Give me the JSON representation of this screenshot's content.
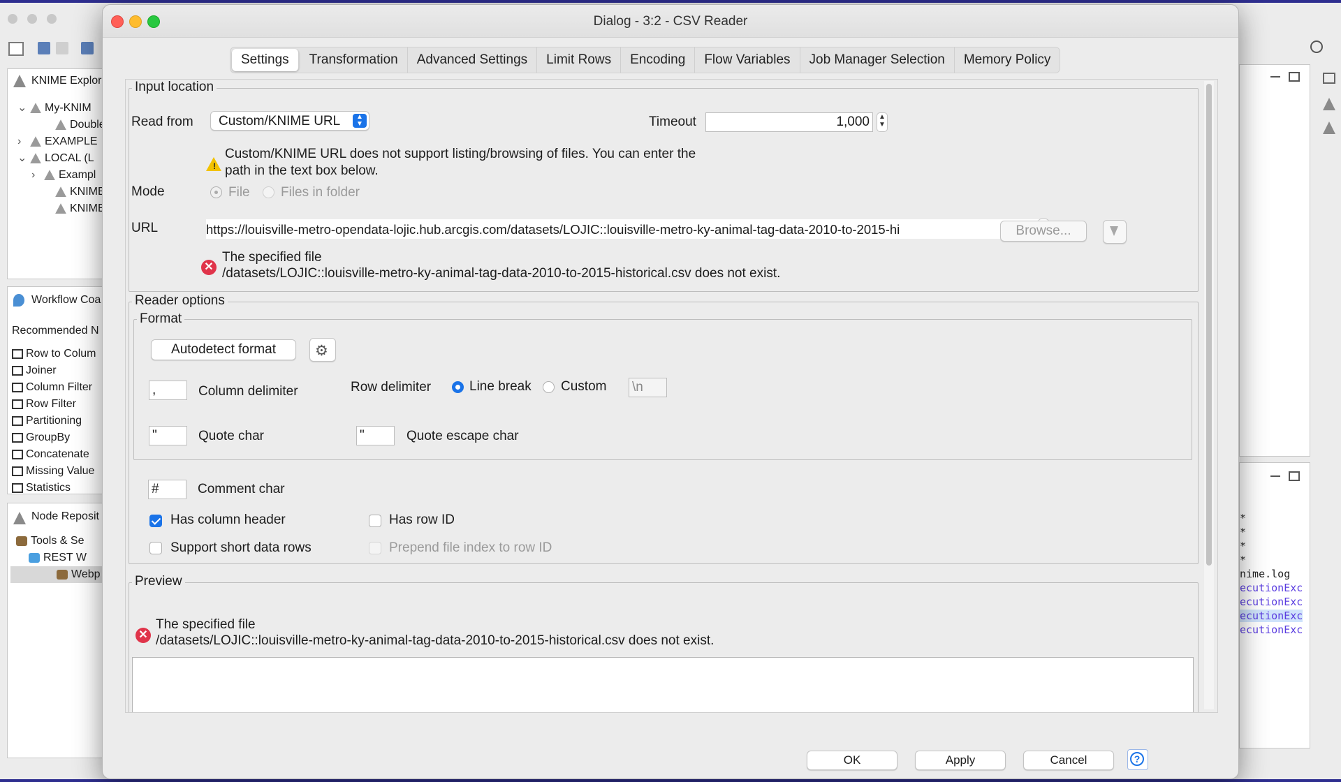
{
  "background": {
    "explorer_title": "KNIME Explor",
    "explorer_items": [
      {
        "toggle": "⌄",
        "label": "My-KNIM"
      },
      {
        "toggle": "",
        "label": "Double"
      },
      {
        "toggle": "›",
        "label": "EXAMPLE"
      },
      {
        "toggle": "⌄",
        "label": "LOCAL (L"
      },
      {
        "toggle": "›",
        "label": "Exampl"
      },
      {
        "toggle": "",
        "label": "KNIME_"
      },
      {
        "toggle": "",
        "label": "KNIME_"
      }
    ],
    "coach_title": "Workflow Coa",
    "recommended_label": "Recommended N",
    "recommended_nodes": [
      "Row to Colum",
      "Joiner",
      "Column Filter",
      "Row Filter",
      "Partitioning",
      "GroupBy",
      "Concatenate",
      "Missing Value",
      "Statistics"
    ],
    "repo_title": "Node Reposit",
    "repo_items": [
      "Tools & Se",
      "REST W",
      "Webp"
    ],
    "console_lines": [
      "*",
      "*",
      "*",
      "*",
      "nime.log",
      "ecutionExc",
      "ecutionExc",
      "ecutionExc",
      "ecutionExc"
    ]
  },
  "dialog": {
    "title": "Dialog - 3:2 - CSV Reader",
    "tabs": [
      "Settings",
      "Transformation",
      "Advanced Settings",
      "Limit Rows",
      "Encoding",
      "Flow Variables",
      "Job Manager Selection",
      "Memory Policy"
    ],
    "input_location": {
      "legend": "Input location",
      "read_from_label": "Read from",
      "read_from_value": "Custom/KNIME URL",
      "timeout_label": "Timeout",
      "timeout_value": "1,000",
      "warning_line1": "Custom/KNIME URL does not support listing/browsing of files. You can enter the",
      "warning_line2": "path in the text box below.",
      "mode_label": "Mode",
      "mode_file": "File",
      "mode_folder": "Files in folder",
      "url_label": "URL",
      "url_value": "https://louisville-metro-opendata-lojic.hub.arcgis.com/datasets/LOJIC::louisville-metro-ky-animal-tag-data-2010-to-2015-hi",
      "browse_label": "Browse...",
      "error_line1": "The specified file",
      "error_line2": "/datasets/LOJIC::louisville-metro-ky-animal-tag-data-2010-to-2015-historical.csv does not exist."
    },
    "reader_options": {
      "legend": "Reader options",
      "format_legend": "Format",
      "autodetect_label": "Autodetect format",
      "column_delimiter_value": ",",
      "column_delimiter_label": "Column delimiter",
      "row_delimiter_label": "Row delimiter",
      "line_break_label": "Line break",
      "custom_label": "Custom",
      "custom_value": "\\n",
      "quote_char_value": "\"",
      "quote_char_label": "Quote char",
      "quote_escape_value": "\"",
      "quote_escape_label": "Quote escape char",
      "comment_char_value": "#",
      "comment_char_label": "Comment char",
      "has_column_header": "Has column header",
      "has_row_id": "Has row ID",
      "support_short_rows": "Support short data rows",
      "prepend_file_index": "Prepend file index to row ID"
    },
    "preview": {
      "legend": "Preview",
      "error_line1": "The specified file",
      "error_line2": "/datasets/LOJIC::louisville-metro-ky-animal-tag-data-2010-to-2015-historical.csv does not exist."
    },
    "buttons": {
      "ok": "OK",
      "apply": "Apply",
      "cancel": "Cancel",
      "help": "?"
    }
  }
}
